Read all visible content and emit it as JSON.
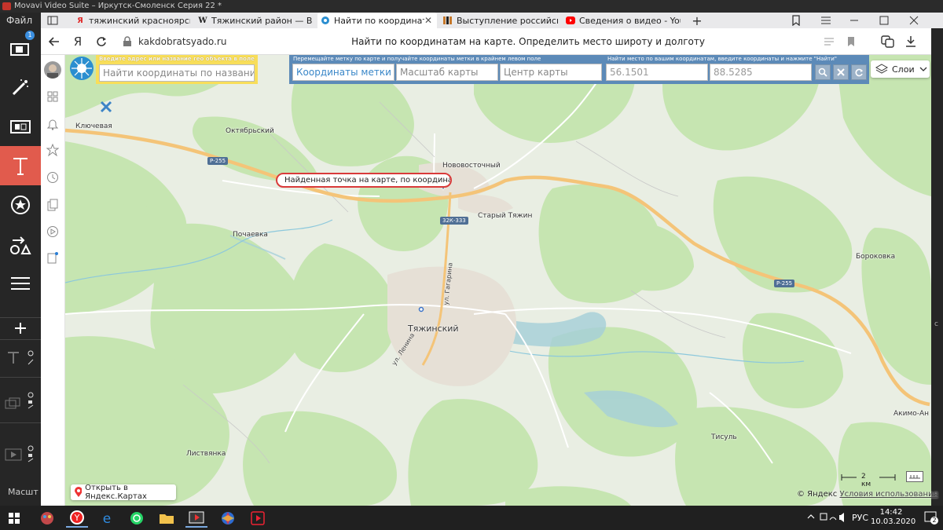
{
  "movavi": {
    "window_title": "Movavi Video Suite – Иркутск-Смоленск Серия 22 *",
    "menu_file": "Файл",
    "zoom_label": "Масшт",
    "badge_count": "1",
    "accent_color": "#e15b4d"
  },
  "browser": {
    "tabs": [
      {
        "label": "тяжинский красноярский к",
        "icon": "yandex-icon",
        "active": false
      },
      {
        "label": "Тяжинский район — Вики",
        "icon": "wikipedia-icon",
        "active": false
      },
      {
        "label": "Найти по координатам",
        "icon": "site-logo-icon",
        "active": true
      },
      {
        "label": "Выступление российского",
        "icon": "site-icon",
        "active": false
      },
      {
        "label": "Сведения о видео - YouTub",
        "icon": "youtube-icon",
        "active": false
      }
    ],
    "new_tab": "+",
    "address_logo": "Я",
    "url": "kakdobratsyado.ru",
    "page_title": "Найти по координатам на карте. Определить место широту и долготу"
  },
  "toolbar": {
    "search_label": "Введите адрес или название гео объекта в поле",
    "search_placeholder": "Найти координаты по названию",
    "marker_label": "Перемещайте метку по карте и получайте координаты метки в крайнем левом поле",
    "marker_coords_placeholder": "Координаты метки",
    "map_scale_placeholder": "Масштаб карты",
    "map_center_placeholder": "Центр карты",
    "find_label": "Найти место по вашим координатам, введите координаты и нажмите \"Найти\"",
    "lat_value": "56.1501",
    "lon_value": "88.5285",
    "layers_label": "Слои"
  },
  "map": {
    "callout": "Найденная точка на карте, по координатам",
    "places": {
      "klyuchevaya": "Ключевая",
      "oktyabrsky": "Октябрьский",
      "novovostochny": "Нововосточный",
      "stary_tyazhin": "Старый Тяжин",
      "pochaevka": "Почаевка",
      "tyazhinsky": "Тяжинский",
      "borokovka": "Бороковка",
      "akimo": "Акимо-Ан",
      "tisul": "Тисуль",
      "listvyanka": "Листвянка"
    },
    "roads": {
      "r255_a": "Р-255",
      "r255_b": "Р-255",
      "k333": "32К-333",
      "gagarina": "ул. Гагарина",
      "lenina": "ул. Ленина"
    },
    "open_in_yandex": "Открыть в Яндекс.Картах",
    "scale": "2 км",
    "copyright": "© Яндекс",
    "terms": "Условия использования"
  },
  "taskbar": {
    "language": "РУС",
    "time": "14:42",
    "date": "10.03.2020",
    "notifications": "2"
  }
}
